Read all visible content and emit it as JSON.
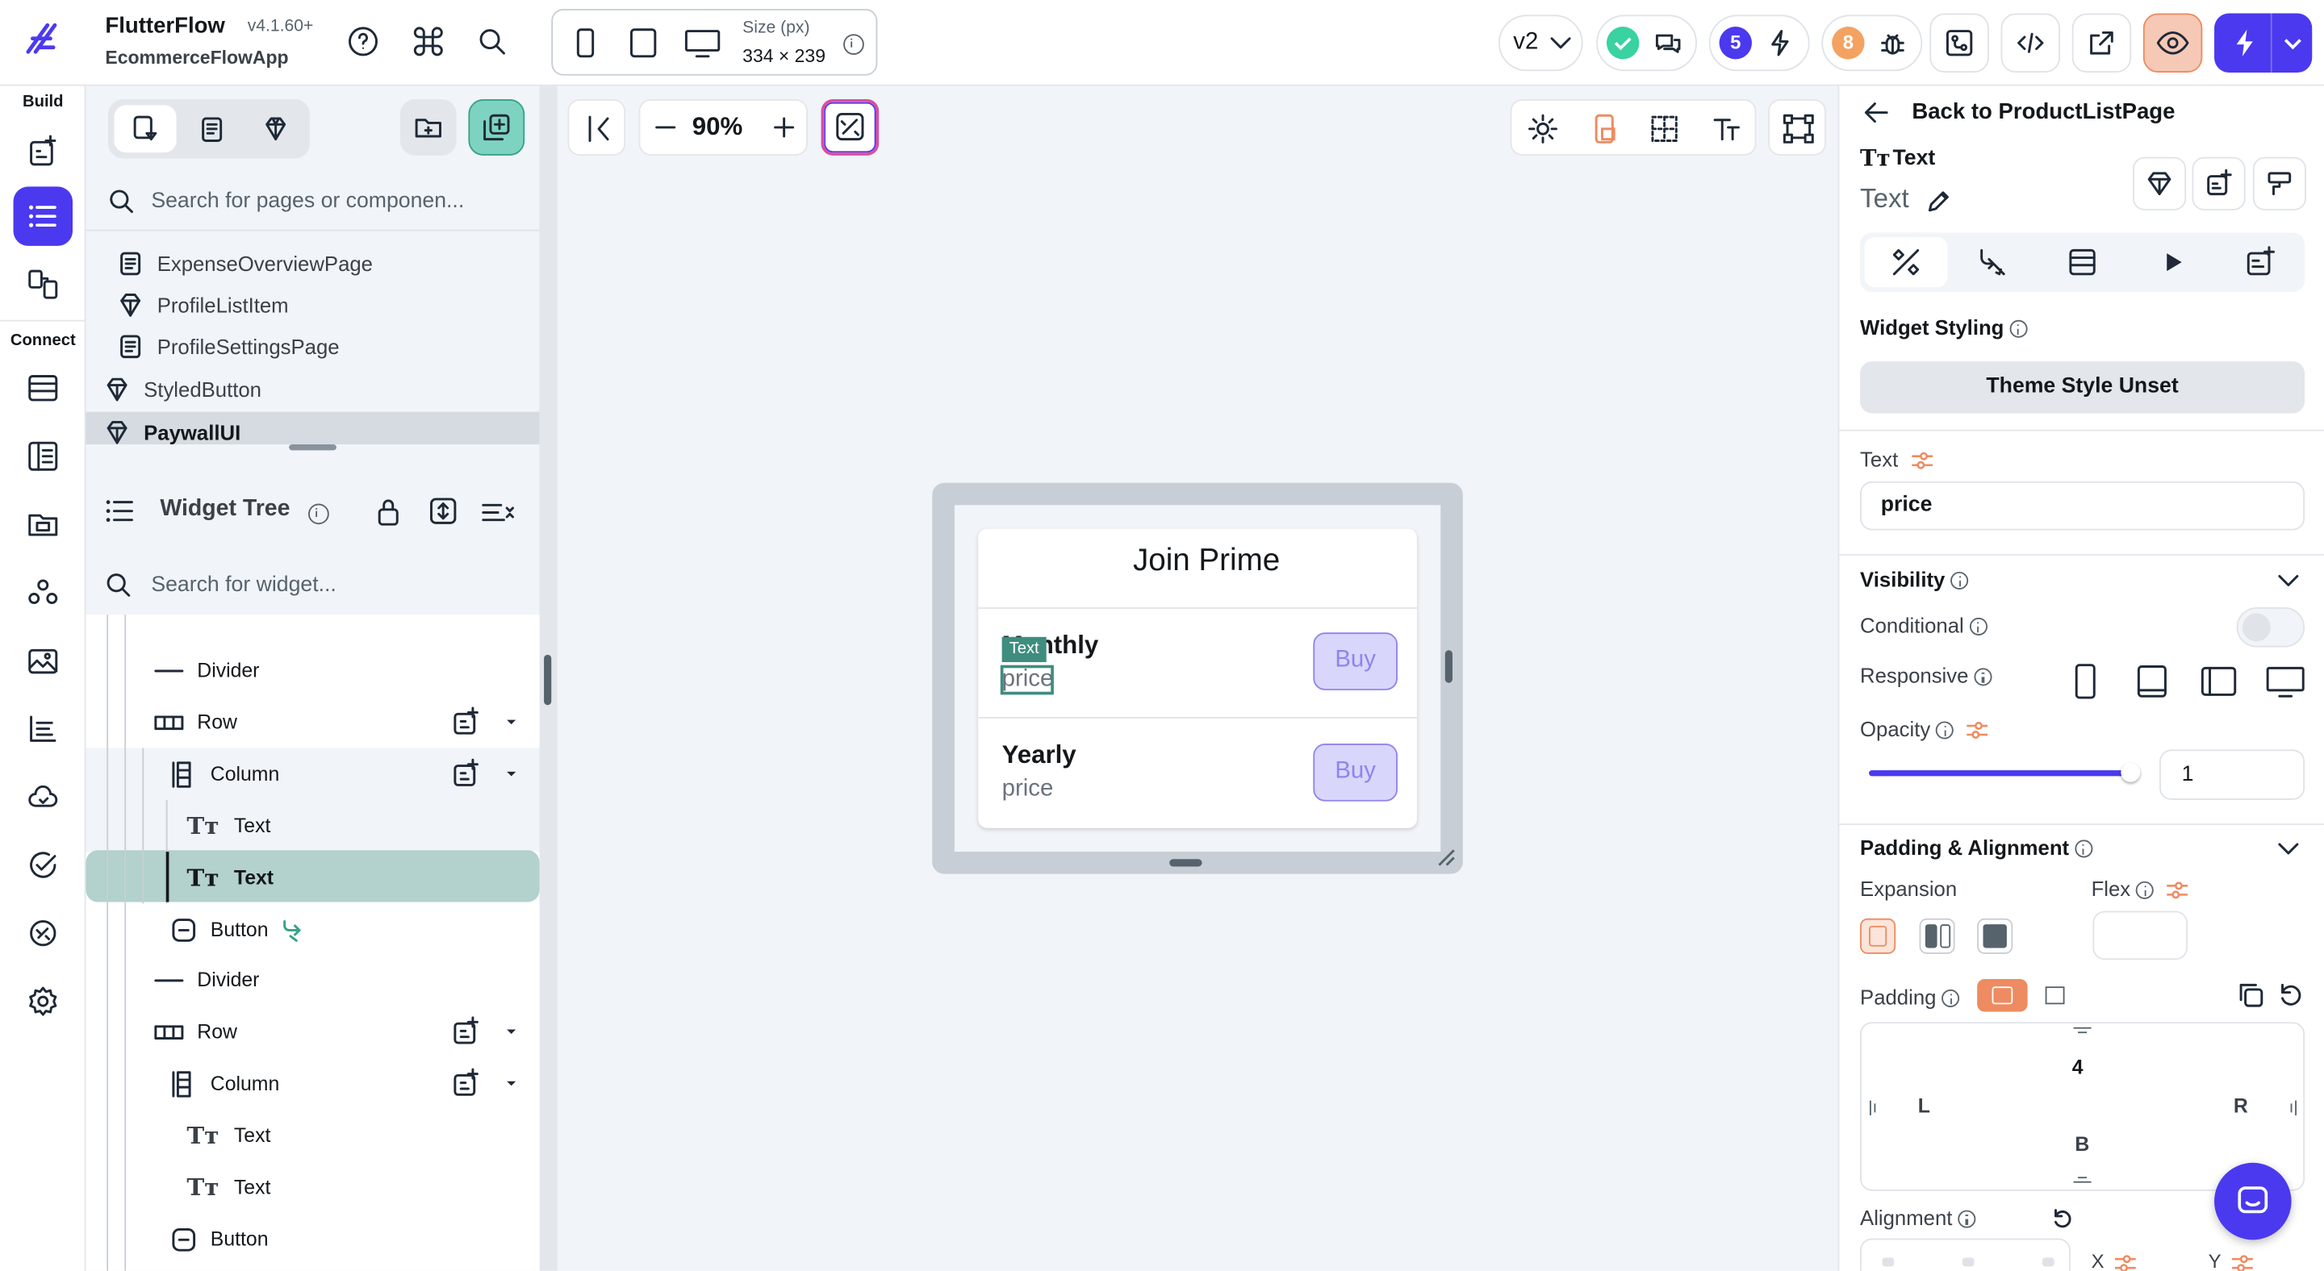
{
  "app": {
    "name": "FlutterFlow",
    "version": "v4.1.60+",
    "project": "EcommerceFlowApp"
  },
  "device": {
    "size_label": "Size (px)",
    "size_value": "334 × 239"
  },
  "topbar": {
    "version_select": "v2",
    "badge_users": "5",
    "badge_issues": "8"
  },
  "rail": {
    "build_label": "Build",
    "connect_label": "Connect"
  },
  "panel": {
    "search_pages_placeholder": "Search for pages or componen...",
    "pages": [
      "ExpenseOverviewPage",
      "ProfileListItem",
      "ProfileSettingsPage",
      "StyledButton",
      "PaywallUI"
    ],
    "widget_tree_title": "Widget Tree",
    "search_widget_placeholder": "Search for widget...",
    "tree": [
      {
        "label": "Divider"
      },
      {
        "label": "Row"
      },
      {
        "label": "Column"
      },
      {
        "label": "Text"
      },
      {
        "label": "Text"
      },
      {
        "label": "Button"
      },
      {
        "label": "Divider"
      },
      {
        "label": "Row"
      },
      {
        "label": "Column"
      },
      {
        "label": "Text"
      },
      {
        "label": "Text"
      },
      {
        "label": "Button"
      }
    ]
  },
  "canvas": {
    "zoom": "90%",
    "preview": {
      "title": "Join Prime",
      "monthly_label": "Monthly",
      "monthly_price": "price",
      "yearly_label": "Yearly",
      "yearly_price": "price",
      "buy_label": "Buy",
      "selection_tag": "Text"
    }
  },
  "props": {
    "back_label": "Back to ProductListPage",
    "widget_type": "Text",
    "widget_name": "Text",
    "widget_styling": "Widget Styling",
    "theme_style": "Theme Style Unset",
    "text_label": "Text",
    "text_value": "price",
    "visibility": "Visibility",
    "conditional": "Conditional",
    "responsive": "Responsive",
    "opacity": "Opacity",
    "opacity_value": "1",
    "opacity_level": 0.98,
    "padding_alignment": "Padding & Alignment",
    "expansion": "Expansion",
    "flex": "Flex",
    "padding": "Padding",
    "pad_top": "4",
    "pad_left": "L",
    "pad_right": "R",
    "pad_bottom": "B",
    "alignment": "Alignment",
    "align_x": "X",
    "align_y": "Y"
  },
  "colors": {
    "accent": "#4b39ef",
    "selection": "#b3d1cd",
    "preview_button": "#d9d6fb",
    "orange": "#ee8b60"
  }
}
